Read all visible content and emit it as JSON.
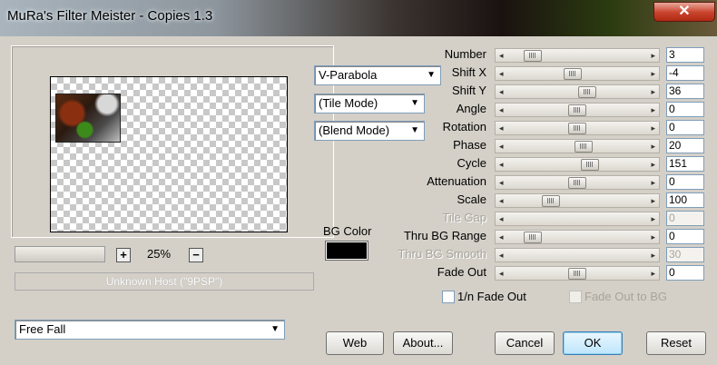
{
  "window": {
    "title": "MuRa's Filter Meister - Copies 1.3",
    "close_glyph": "✕"
  },
  "preview": {
    "zoom": "25%",
    "zoom_in": "+",
    "zoom_out": "−",
    "host_text": "Unknown Host (\"9PSP\")"
  },
  "dropdowns": {
    "shape": "V-Parabola",
    "tile_mode": "(Tile Mode)",
    "blend_mode": "(Blend Mode)",
    "preset": "Free Fall"
  },
  "bg_color": {
    "label": "BG Color",
    "color": "#000000"
  },
  "params": [
    {
      "label": "Number",
      "value": "3",
      "pos": 0.14,
      "disabled": false
    },
    {
      "label": "Shift X",
      "value": "-4",
      "pos": 0.46,
      "disabled": false
    },
    {
      "label": "Shift Y",
      "value": "36",
      "pos": 0.58,
      "disabled": false
    },
    {
      "label": "Angle",
      "value": "0",
      "pos": 0.5,
      "disabled": false
    },
    {
      "label": "Rotation",
      "value": "0",
      "pos": 0.5,
      "disabled": false
    },
    {
      "label": "Phase",
      "value": "20",
      "pos": 0.55,
      "disabled": false
    },
    {
      "label": "Cycle",
      "value": "151",
      "pos": 0.6,
      "disabled": false
    },
    {
      "label": "Attenuation",
      "value": "0",
      "pos": 0.5,
      "disabled": false
    },
    {
      "label": "Scale",
      "value": "100",
      "pos": 0.29,
      "disabled": false
    },
    {
      "label": "Tile Gap",
      "value": "0",
      "pos": 0.0,
      "disabled": true
    },
    {
      "label": "Thru BG Range",
      "value": "0",
      "pos": 0.14,
      "disabled": false
    },
    {
      "label": "Thru BG Smooth",
      "value": "30",
      "pos": 0.0,
      "disabled": true
    },
    {
      "label": "Fade Out",
      "value": "0",
      "pos": 0.5,
      "disabled": false
    }
  ],
  "checkboxes": {
    "fade_1n": "1/n Fade Out",
    "fade_bg": "Fade Out to BG"
  },
  "buttons": {
    "web": "Web",
    "about": "About...",
    "cancel": "Cancel",
    "ok": "OK",
    "reset": "Reset"
  },
  "slider_arrows": {
    "left": "◂",
    "right": "▸"
  },
  "dropdown_arrow": "▼"
}
